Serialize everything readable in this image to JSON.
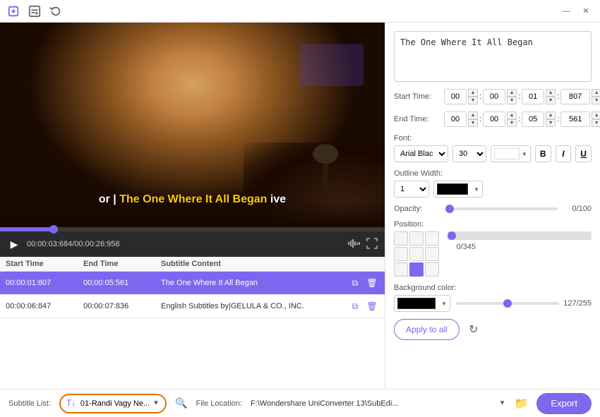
{
  "titlebar": {
    "minimize_label": "—",
    "close_label": "✕"
  },
  "toolbar": {
    "icon1": "➕",
    "icon2": "⊞",
    "icon3": "↻"
  },
  "video": {
    "overlay_text_before": "or |",
    "overlay_text_highlight": "The One Where It All Began",
    "overlay_text_after": "ive",
    "time_current": "00:00:03:684",
    "time_total": "00:00:26:958"
  },
  "subtitle_table": {
    "headers": [
      "Start Time",
      "End Time",
      "Subtitle Content",
      ""
    ],
    "rows": [
      {
        "start": "00:00:01:807",
        "end": "00:00:05:561",
        "content": "The One Where It All Began",
        "selected": true
      },
      {
        "start": "00:00:06:847",
        "end": "00:00:07:836",
        "content": "English Subtitles by|GELULA & CO., INC.",
        "selected": false
      }
    ]
  },
  "right_panel": {
    "subtitle_text": "The One Where It All Began",
    "start_time": {
      "label": "Start Time:",
      "h": "00",
      "m": "00",
      "s": "01",
      "ms": "807"
    },
    "end_time": {
      "label": "End Time:",
      "h": "00",
      "m": "00",
      "s": "05",
      "ms": "561"
    },
    "font": {
      "label": "Font:",
      "family": "Arial Blac",
      "size": "30",
      "bold": "B",
      "italic": "I",
      "underline": "U"
    },
    "outline": {
      "label": "Outline Width:",
      "width": "1"
    },
    "opacity": {
      "label": "Opacity:",
      "value": "0/100"
    },
    "position": {
      "label": "Position:",
      "value": "0/345"
    },
    "background_color": {
      "label": "Background color:",
      "value": "127/255"
    },
    "apply_all_label": "Apply to all"
  },
  "bottom_bar": {
    "subtitle_list_label": "Subtitle List:",
    "subtitle_list_value": "T↓01-Randi Vagy Ne...",
    "file_location_label": "File Location:",
    "file_location_value": "F:\\Wondershare UniConverter 13\\SubEdi...",
    "export_label": "Export"
  }
}
